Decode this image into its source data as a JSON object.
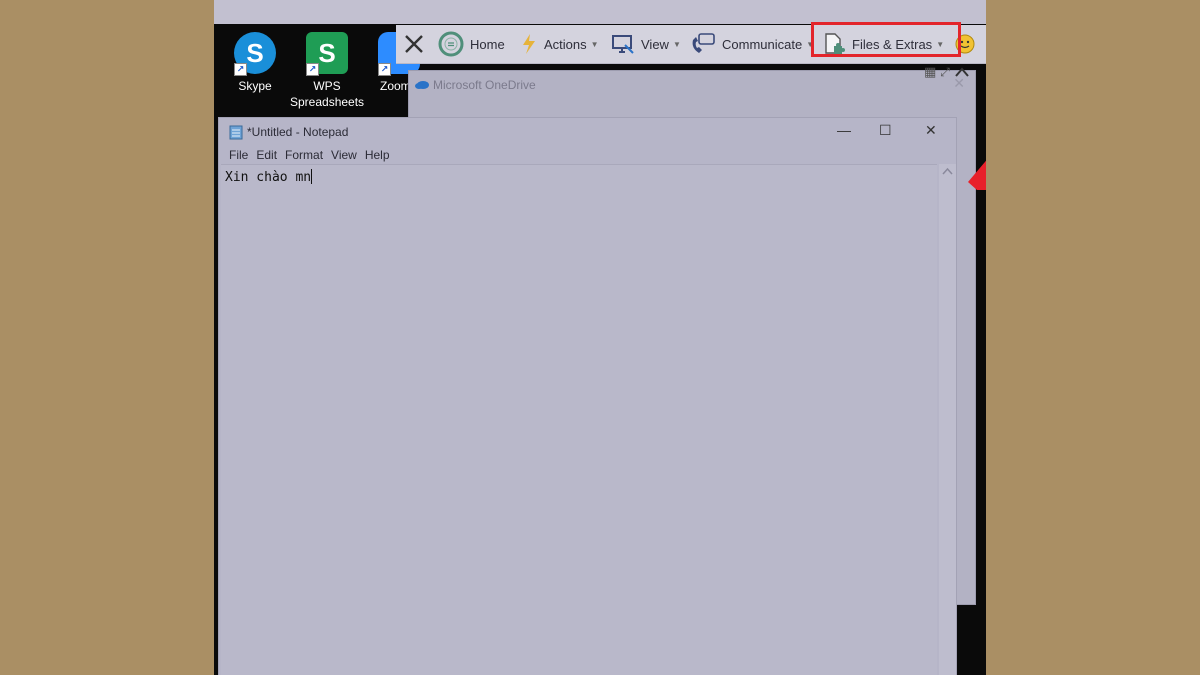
{
  "desktop": {
    "icons": [
      {
        "label": "Skype",
        "color": "#1a8fd9",
        "glyph": "S"
      },
      {
        "label": "WPS\nSpreadsheets",
        "color": "#1f9d55",
        "glyph": "S"
      },
      {
        "label": "Zoom",
        "color": "#2d8cff",
        "glyph": ""
      }
    ]
  },
  "toolbar": {
    "home": "Home",
    "actions": "Actions",
    "view": "View",
    "communicate": "Communicate",
    "files_extras": "Files & Extras"
  },
  "onedrive": {
    "title": "Microsoft OneDrive"
  },
  "notepad": {
    "title": "*Untitled - Notepad",
    "menu": [
      "File",
      "Edit",
      "Format",
      "View",
      "Help"
    ],
    "content": "Xin chào mn"
  },
  "annotation": {
    "highlight_color": "#e3252b",
    "arrow_color": "#e8202a"
  }
}
